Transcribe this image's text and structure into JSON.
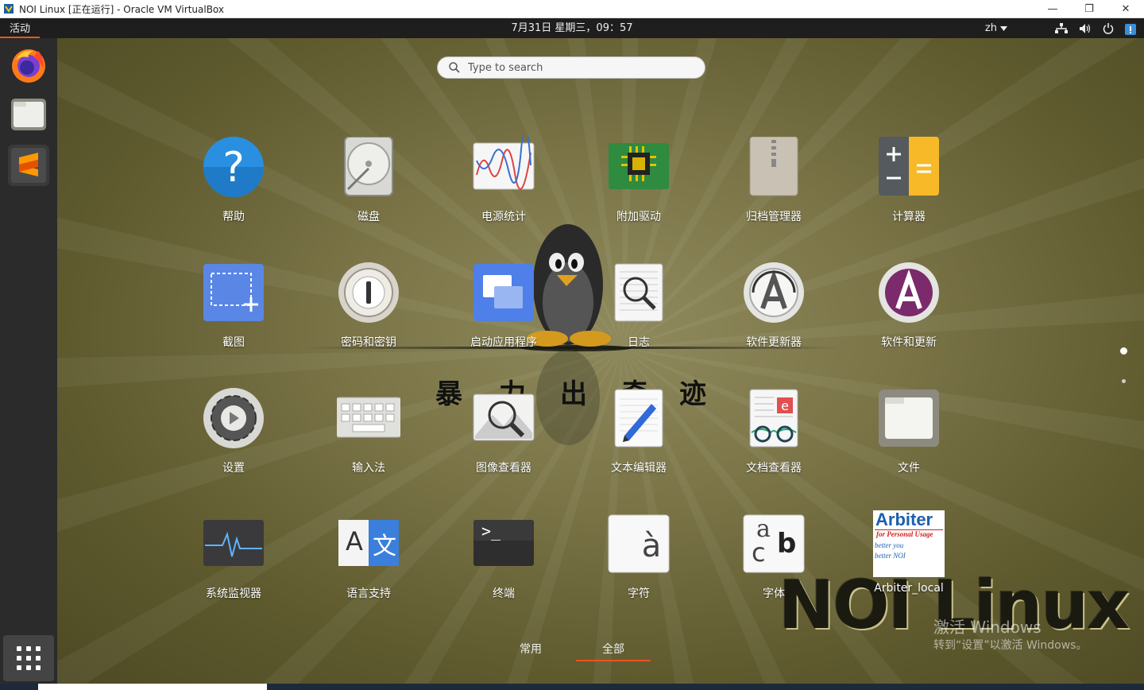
{
  "window": {
    "title": "NOI Linux [正在运行] - Oracle VM VirtualBox",
    "controls": [
      "—",
      "❐",
      "✕"
    ]
  },
  "topbar": {
    "activities": "活动",
    "clock": "7月31日 星期三，09：57",
    "language": "zh",
    "tray_icons": [
      "network-icon",
      "volume-icon",
      "power-icon"
    ]
  },
  "dock": {
    "items": [
      "firefox",
      "files",
      "sublime-text"
    ]
  },
  "search": {
    "placeholder": "Type to search"
  },
  "apps": [
    {
      "label": "帮助",
      "icon": "help-icon"
    },
    {
      "label": "磁盘",
      "icon": "disk-icon"
    },
    {
      "label": "电源统计",
      "icon": "power-statistics-icon"
    },
    {
      "label": "附加驱动",
      "icon": "additional-drivers-icon"
    },
    {
      "label": "归档管理器",
      "icon": "archive-manager-icon"
    },
    {
      "label": "计算器",
      "icon": "calculator-icon"
    },
    {
      "label": "截图",
      "icon": "screenshot-icon"
    },
    {
      "label": "密码和密钥",
      "icon": "passwords-keys-icon"
    },
    {
      "label": "启动应用程序",
      "icon": "startup-apps-icon"
    },
    {
      "label": "日志",
      "icon": "logs-icon"
    },
    {
      "label": "软件更新器",
      "icon": "software-updater-icon"
    },
    {
      "label": "软件和更新",
      "icon": "software-updates-icon"
    },
    {
      "label": "设置",
      "icon": "settings-icon"
    },
    {
      "label": "输入法",
      "icon": "input-method-icon"
    },
    {
      "label": "图像查看器",
      "icon": "image-viewer-icon"
    },
    {
      "label": "文本编辑器",
      "icon": "text-editor-icon"
    },
    {
      "label": "文档查看器",
      "icon": "document-viewer-icon"
    },
    {
      "label": "文件",
      "icon": "files-icon"
    },
    {
      "label": "系统监视器",
      "icon": "system-monitor-icon"
    },
    {
      "label": "语言支持",
      "icon": "language-support-icon"
    },
    {
      "label": "终端",
      "icon": "terminal-icon"
    },
    {
      "label": "字符",
      "icon": "characters-icon"
    },
    {
      "label": "字体",
      "icon": "fonts-icon"
    },
    {
      "label": "Arbiter_local",
      "icon": "arbiter-icon"
    }
  ],
  "arbiter_logo": {
    "title": "Arbiter",
    "line1": "for Personal Usage",
    "line2": "better you",
    "line3": "better NOI"
  },
  "terminal_prompt": ">_",
  "character_glyph": "à",
  "font_glyphs": {
    "a": "a",
    "b": "b",
    "c": "c"
  },
  "language_glyphs": {
    "left": "A",
    "right": "文"
  },
  "tabs": {
    "frequent": "常用",
    "all": "全部"
  },
  "wallpaper": {
    "logo": "NOI Linux",
    "calligraphy": [
      "暴",
      "力",
      "出",
      "奇",
      "迹"
    ]
  },
  "activation": {
    "title": "激活 Windows",
    "subtitle": "转到“设置”以激活 Windows。"
  },
  "colors": {
    "accent": "#e95420",
    "dock": "#2b2b2b",
    "topbar": "#1e1e1e"
  }
}
